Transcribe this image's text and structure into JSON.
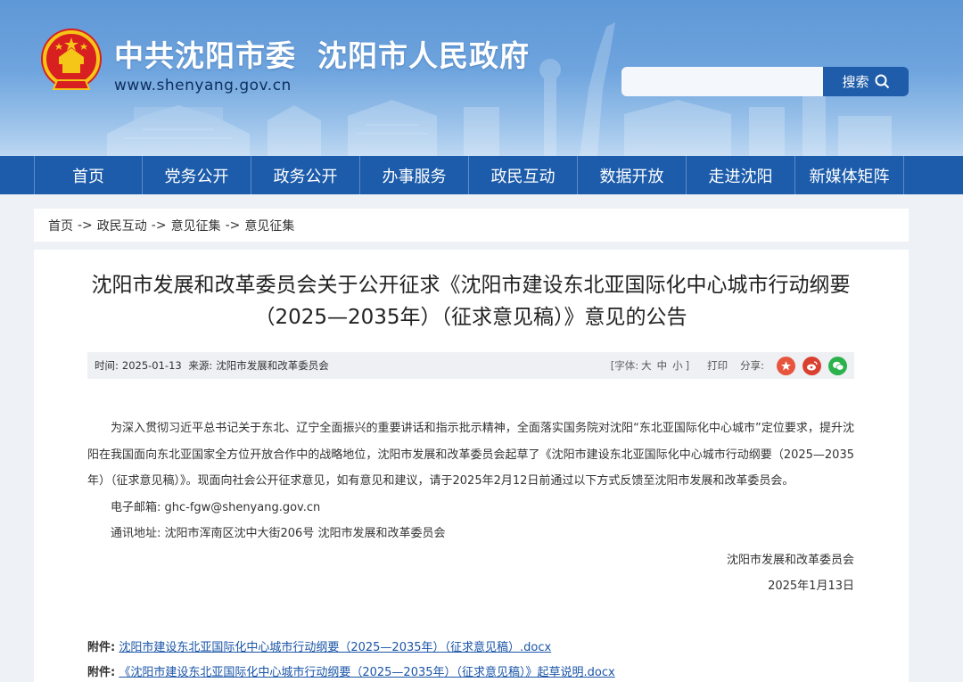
{
  "header": {
    "title_left": "中共沈阳市委",
    "title_right": "沈阳市人民政府",
    "url": "www.shenyang.gov.cn",
    "search_value": "",
    "search_button": "搜索"
  },
  "nav": [
    "首页",
    "党务公开",
    "政务公开",
    "办事服务",
    "政民互动",
    "数据开放",
    "走进沈阳",
    "新媒体矩阵"
  ],
  "breadcrumb": [
    "首页",
    "政民互动",
    "意见征集",
    "意见征集"
  ],
  "breadcrumb_sep": "->",
  "article": {
    "title": "沈阳市发展和改革委员会关于公开征求《沈阳市建设东北亚国际化中心城市行动纲要（2025—2035年）（征求意见稿）》意见的公告",
    "meta": {
      "time_label": "时间:",
      "time": "2025-01-13",
      "source_label": "来源:",
      "source": "沈阳市发展和改革委员会",
      "font_label": "[字体:",
      "font_sizes": [
        "大",
        "中",
        "小"
      ],
      "font_close": "]",
      "print": "打印",
      "share": "分享:"
    },
    "paragraph": "为深入贯彻习近平总书记关于东北、辽宁全面振兴的重要讲话和指示批示精神，全面落实国务院对沈阳“东北亚国际化中心城市”定位要求，提升沈阳在我国面向东北亚国家全方位开放合作中的战略地位，沈阳市发展和改革委员会起草了《沈阳市建设东北亚国际化中心城市行动纲要（2025—2035年）（征求意见稿）》。现面向社会公开征求意见，如有意见和建议，请于2025年2月12日前通过以下方式反馈至沈阳市发展和改革委员会。",
    "email": "电子邮箱:  ghc-fgw@shenyang.gov.cn",
    "address": "通讯地址:  沈阳市浑南区沈中大街206号 沈阳市发展和改革委员会",
    "sign_org": "沈阳市发展和改革委员会",
    "sign_date": "2025年1月13日",
    "attachments": [
      {
        "label": "附件:",
        "name": "沈阳市建设东北亚国际化中心城市行动纲要（2025—2035年）（征求意见稿）.docx"
      },
      {
        "label": "附件:",
        "name": "《沈阳市建设东北亚国际化中心城市行动纲要（2025—2035年）（征求意见稿）》起草说明.docx"
      }
    ]
  },
  "colors": {
    "nav_bg": "#1c5cab",
    "search_btn": "#1f5ca9",
    "link": "#1a55a8",
    "share_weibo_a": "#e8553e",
    "share_weibo_b": "#d9402f",
    "share_wechat": "#2bb24c"
  }
}
